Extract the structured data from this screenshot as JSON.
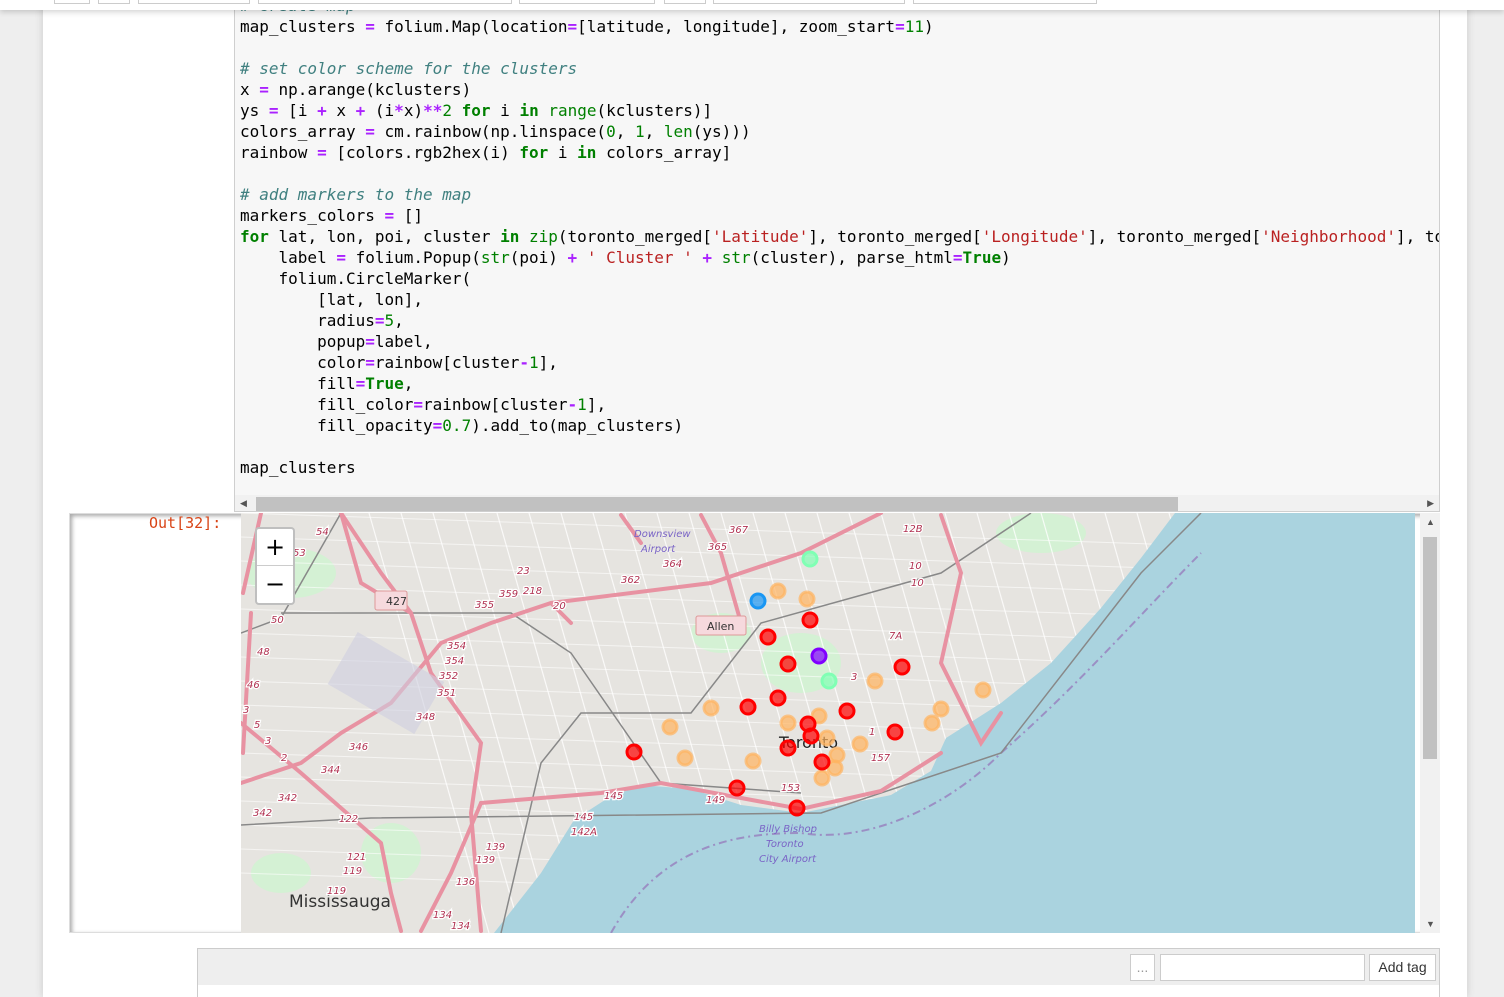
{
  "cell": {
    "code_lines": [
      [
        [
          "# create map",
          "cm"
        ]
      ],
      [
        [
          "map_clusters ",
          ""
        ],
        [
          "=",
          "op"
        ],
        [
          " folium.Map(location",
          ""
        ],
        [
          "=",
          "op"
        ],
        [
          "[latitude, longitude], zoom_start",
          ""
        ],
        [
          "=",
          "op"
        ],
        [
          "11",
          "nu"
        ],
        [
          ")",
          ""
        ]
      ],
      [],
      [
        [
          "# set color scheme for the clusters",
          "cm"
        ]
      ],
      [
        [
          "x ",
          ""
        ],
        [
          "=",
          "op"
        ],
        [
          " np.arange(kclusters)",
          ""
        ]
      ],
      [
        [
          "ys ",
          ""
        ],
        [
          "=",
          "op"
        ],
        [
          " [i ",
          ""
        ],
        [
          "+",
          "op"
        ],
        [
          " x ",
          ""
        ],
        [
          "+",
          "op"
        ],
        [
          " (i",
          ""
        ],
        [
          "*",
          "op"
        ],
        [
          "x)",
          ""
        ],
        [
          "**",
          "op"
        ],
        [
          "2",
          "nu"
        ],
        [
          " ",
          ""
        ],
        [
          "for",
          "kw"
        ],
        [
          " i ",
          ""
        ],
        [
          "in",
          "kw"
        ],
        [
          " ",
          ""
        ],
        [
          "range",
          "bi"
        ],
        [
          "(kclusters)]",
          ""
        ]
      ],
      [
        [
          "colors_array ",
          ""
        ],
        [
          "=",
          "op"
        ],
        [
          " cm.rainbow(np.linspace(",
          ""
        ],
        [
          "0",
          "nu"
        ],
        [
          ", ",
          ""
        ],
        [
          "1",
          "nu"
        ],
        [
          ", ",
          ""
        ],
        [
          "len",
          "bi"
        ],
        [
          "(ys)))",
          ""
        ]
      ],
      [
        [
          "rainbow ",
          ""
        ],
        [
          "=",
          "op"
        ],
        [
          " [colors.rgb2hex(i) ",
          ""
        ],
        [
          "for",
          "kw"
        ],
        [
          " i ",
          ""
        ],
        [
          "in",
          "kw"
        ],
        [
          " colors_array]",
          ""
        ]
      ],
      [],
      [
        [
          "# add markers to the map",
          "cm"
        ]
      ],
      [
        [
          "markers_colors ",
          ""
        ],
        [
          "=",
          "op"
        ],
        [
          " []",
          ""
        ]
      ],
      [
        [
          "for",
          "kw"
        ],
        [
          " lat, lon, poi, cluster ",
          ""
        ],
        [
          "in",
          "kw"
        ],
        [
          " ",
          ""
        ],
        [
          "zip",
          "bi"
        ],
        [
          "(toronto_merged[",
          ""
        ],
        [
          "'Latitude'",
          "st"
        ],
        [
          "], toronto_merged[",
          ""
        ],
        [
          "'Longitude'",
          "st"
        ],
        [
          "], toronto_merged[",
          ""
        ],
        [
          "'Neighborhood'",
          "st"
        ],
        [
          "], to",
          ""
        ]
      ],
      [
        [
          "    label ",
          ""
        ],
        [
          "=",
          "op"
        ],
        [
          " folium.Popup(",
          ""
        ],
        [
          "str",
          "bi"
        ],
        [
          "(poi) ",
          ""
        ],
        [
          "+",
          "op"
        ],
        [
          " ",
          ""
        ],
        [
          "' Cluster '",
          "st"
        ],
        [
          " ",
          ""
        ],
        [
          "+",
          "op"
        ],
        [
          " ",
          ""
        ],
        [
          "str",
          "bi"
        ],
        [
          "(cluster), parse_html",
          ""
        ],
        [
          "=",
          "op"
        ],
        [
          "True",
          "kw"
        ],
        [
          ")",
          ""
        ]
      ],
      [
        [
          "    folium.CircleMarker(",
          ""
        ]
      ],
      [
        [
          "        [lat, lon],",
          ""
        ]
      ],
      [
        [
          "        radius",
          ""
        ],
        [
          "=",
          "op"
        ],
        [
          "5",
          "nu"
        ],
        [
          ",",
          ""
        ]
      ],
      [
        [
          "        popup",
          ""
        ],
        [
          "=",
          "op"
        ],
        [
          "label,",
          ""
        ]
      ],
      [
        [
          "        color",
          ""
        ],
        [
          "=",
          "op"
        ],
        [
          "rainbow[cluster",
          ""
        ],
        [
          "-",
          "op"
        ],
        [
          "1",
          "nu"
        ],
        [
          "],",
          ""
        ]
      ],
      [
        [
          "        fill",
          ""
        ],
        [
          "=",
          "op"
        ],
        [
          "True",
          "kw"
        ],
        [
          ",",
          ""
        ]
      ],
      [
        [
          "        fill_color",
          ""
        ],
        [
          "=",
          "op"
        ],
        [
          "rainbow[cluster",
          ""
        ],
        [
          "-",
          "op"
        ],
        [
          "1",
          "nu"
        ],
        [
          "],",
          ""
        ]
      ],
      [
        [
          "        fill_opacity",
          ""
        ],
        [
          "=",
          "op"
        ],
        [
          "0.7",
          "nu"
        ],
        [
          ").add_to(map_clusters)",
          ""
        ]
      ],
      [],
      [
        [
          "map_clusters",
          ""
        ]
      ]
    ]
  },
  "output": {
    "prompt": "Out[32]:",
    "map": {
      "zoom_in": "+",
      "zoom_out": "−",
      "labels": [
        "Mississauga",
        "Toronto",
        "Downsview",
        "Airport",
        "Billy Bishop",
        "Toronto",
        "City Airport",
        "Allen",
        "427",
        "54",
        "53",
        "50",
        "48",
        "46",
        "3",
        "5",
        "3",
        "2",
        "342",
        "342",
        "344",
        "346",
        "348",
        "351",
        "352",
        "354",
        "354",
        "355",
        "359",
        "218",
        "20",
        "23",
        "362",
        "364",
        "365",
        "367",
        "12B",
        "10",
        "10",
        "7A",
        "3",
        "1",
        "157",
        "153",
        "149",
        "145",
        "145",
        "142A",
        "139",
        "139",
        "136",
        "134",
        "134",
        "122",
        "121",
        "119",
        "119"
      ],
      "marker_colors": {
        "red": "#ff0000",
        "orange": "#ffb360",
        "teal": "#80ffb4",
        "blue": "#1996f3",
        "purple": "#8000ff"
      },
      "colors": {
        "water": "#aad3df",
        "land": "#e6e4e0",
        "highway": "#e892a2",
        "park": "#c8facc"
      }
    }
  },
  "tags": {
    "more_label": "...",
    "input_value": "",
    "add_label": "Add tag"
  }
}
